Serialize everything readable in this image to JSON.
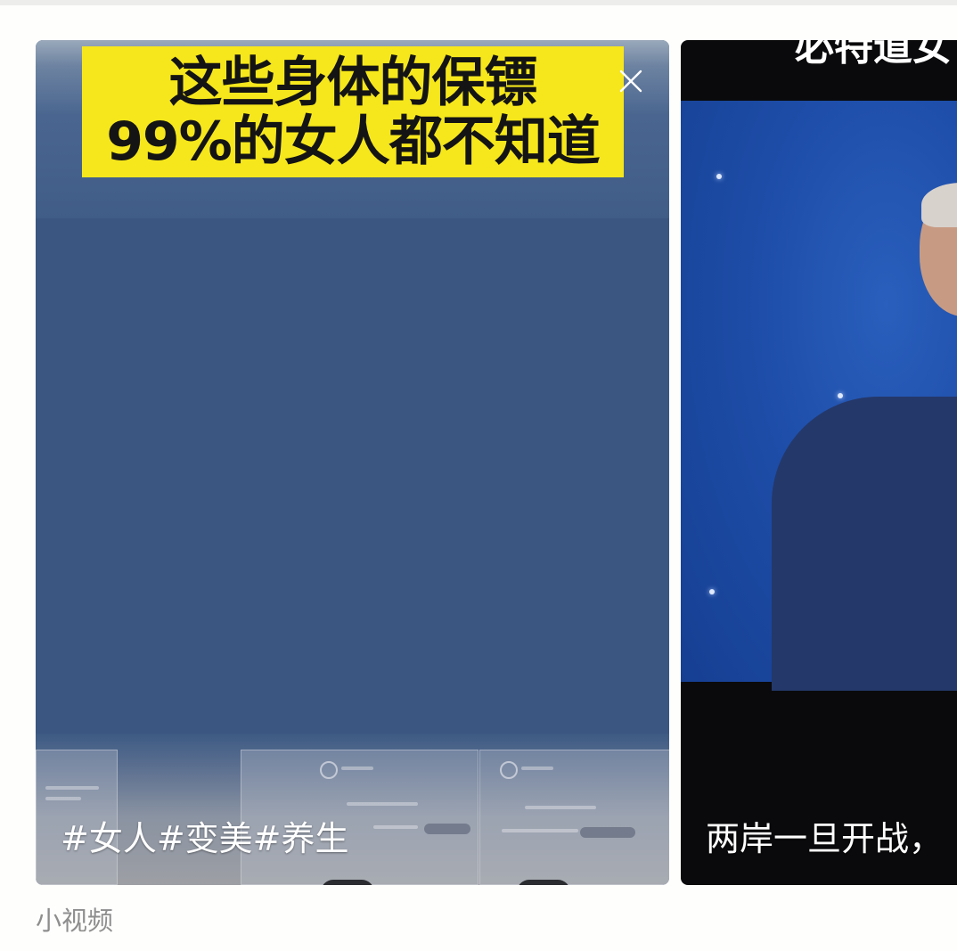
{
  "cards": [
    {
      "title_lines": [
        "这些身体的保镖",
        "99%的女人都不知道"
      ],
      "caption": "#女人#变美#养生"
    },
    {
      "top_text": "必特道女",
      "caption": "两岸一旦开战，"
    }
  ],
  "section_label": "小视频",
  "close_icon": "close-icon",
  "colors": {
    "title_bg": "#f6e71c",
    "card1_bg": "#3d5a84",
    "card2_screen": "#1d4da8",
    "page_bg": "#fefefc",
    "label_gray": "#8e8e8e"
  }
}
